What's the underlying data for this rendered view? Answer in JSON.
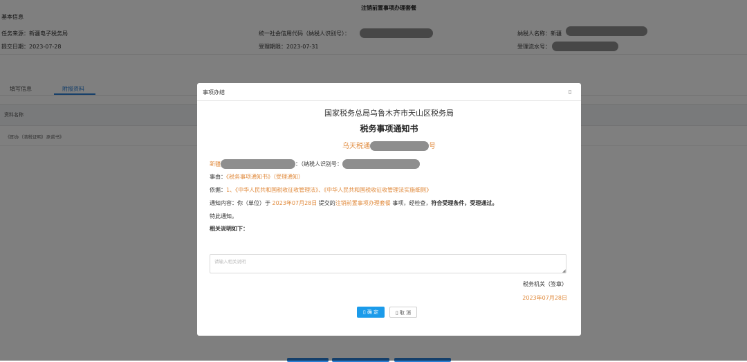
{
  "page": {
    "title": "注销前置事项办理套餐",
    "section_basic": "基本信息"
  },
  "info": {
    "task_source": "任务来源：新疆电子税务局",
    "submit_date": "提交日期：2023-07-28",
    "credit_code_label": "统一社会信用代码（纳税人识别号）：",
    "deadline": "受理期限：2023-07-31",
    "taxpayer_name_label": "纳税人名称：新疆",
    "serial_label": "受理流水号："
  },
  "tabs": [
    "填写信息",
    "附报资料"
  ],
  "table": {
    "header": "资料名称",
    "rows": [
      "《即办（清税证明）承诺书》"
    ]
  },
  "modal": {
    "title": "事项办结",
    "close": "▯",
    "bureau": "国家税务总局乌鲁木齐市天山区税务局",
    "doc_title": "税务事项通知书",
    "doc_number_prefix": "乌天税通",
    "doc_number_suffix": "号",
    "recipient_prefix": "新疆",
    "taxpayer_id_label": "：（纳税人识别号：",
    "reason_label": "事由：",
    "reason_value": "《税务事项通知书》（受理通知）",
    "basis_label": "依据：",
    "basis_value": "1、《中华人民共和国税收征收管理法》、《中华人民共和国税收征收管理法实施细则》",
    "content_label": "通知内容：你（单位）于 ",
    "content_date": "2023年07月28日",
    "content_mid": " 提交的",
    "content_item": "注销前置事项办理套餐",
    "content_tail1": " 事项，经检查，",
    "content_tail2": "符合受理条件，受理通过。",
    "notice_end": "特此通知。",
    "related_label": "相关说明如下：",
    "remark_placeholder": "请输入相关说明",
    "seal_label": "税务机关（签章）",
    "sign_date": "2023年07月28日",
    "confirm_label": "▯ 确 定",
    "cancel_label": "▯ 取 消"
  },
  "colors": {
    "accent_orange": "#e08a3c",
    "primary_blue": "#1b9bea",
    "tab_blue": "#2a7fd4"
  }
}
